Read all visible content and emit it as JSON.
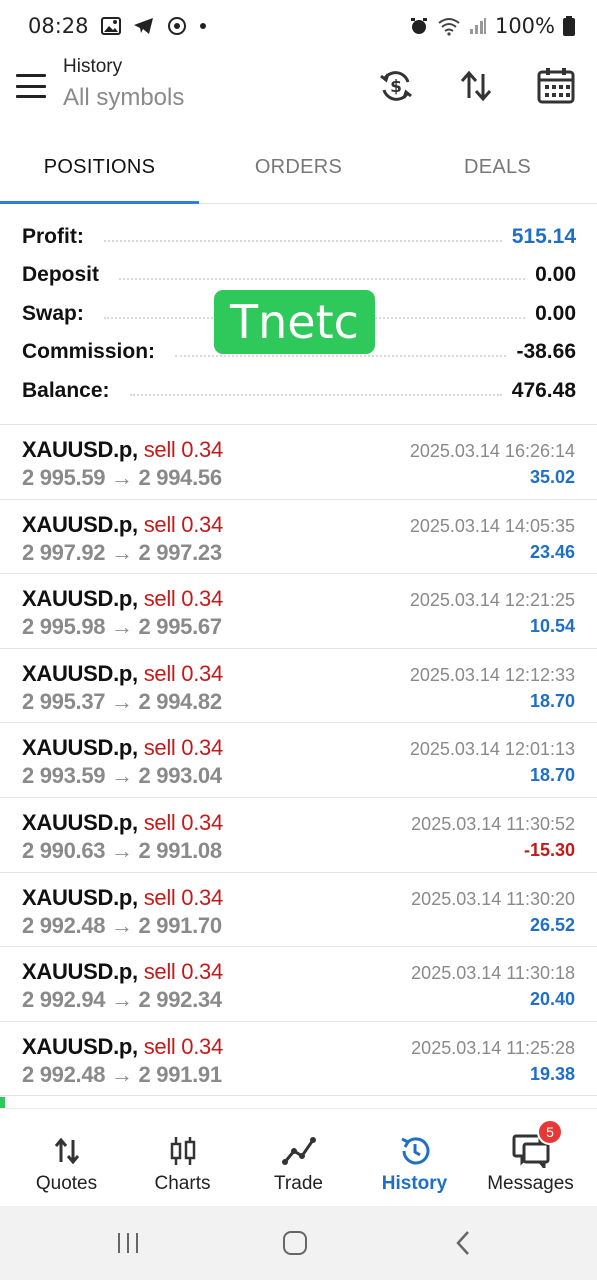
{
  "status_bar": {
    "time": "08:28",
    "battery": "100%",
    "left_icons": [
      "gallery-icon",
      "telegram-icon",
      "app-icon",
      "dot-icon"
    ],
    "right_icons": [
      "alarm-icon",
      "wifi-icon",
      "signal-icon",
      "battery-icon"
    ]
  },
  "header": {
    "title": "History",
    "subtitle": "All symbols",
    "icons": [
      "currency-sync-icon",
      "sort-icon",
      "calendar-icon"
    ]
  },
  "tabs": [
    {
      "label": "POSITIONS",
      "active": true
    },
    {
      "label": "ORDERS",
      "active": false
    },
    {
      "label": "DEALS",
      "active": false
    }
  ],
  "summary": {
    "profit_label": "Profit:",
    "profit_value": "515.14",
    "deposit_label": "Deposit",
    "deposit_value": "0.00",
    "swap_label": "Swap:",
    "swap_value": "0.00",
    "commission_label": "Commission:",
    "commission_value": "-38.66",
    "balance_label": "Balance:",
    "balance_value": "476.48"
  },
  "watermark": "Tnetc",
  "deals": [
    {
      "symbol": "XAUUSD.p,",
      "side": "sell 0.34",
      "prices": "2 995.59 → 2 994.56",
      "time": "2025.03.14 16:26:14",
      "profit": "35.02",
      "negative": false
    },
    {
      "symbol": "XAUUSD.p,",
      "side": "sell 0.34",
      "prices": "2 997.92 → 2 997.23",
      "time": "2025.03.14 14:05:35",
      "profit": "23.46",
      "negative": false
    },
    {
      "symbol": "XAUUSD.p,",
      "side": "sell 0.34",
      "prices": "2 995.98 → 2 995.67",
      "time": "2025.03.14 12:21:25",
      "profit": "10.54",
      "negative": false
    },
    {
      "symbol": "XAUUSD.p,",
      "side": "sell 0.34",
      "prices": "2 995.37 → 2 994.82",
      "time": "2025.03.14 12:12:33",
      "profit": "18.70",
      "negative": false
    },
    {
      "symbol": "XAUUSD.p,",
      "side": "sell 0.34",
      "prices": "2 993.59 → 2 993.04",
      "time": "2025.03.14 12:01:13",
      "profit": "18.70",
      "negative": false
    },
    {
      "symbol": "XAUUSD.p,",
      "side": "sell 0.34",
      "prices": "2 990.63 → 2 991.08",
      "time": "2025.03.14 11:30:52",
      "profit": "-15.30",
      "negative": true
    },
    {
      "symbol": "XAUUSD.p,",
      "side": "sell 0.34",
      "prices": "2 992.48 → 2 991.70",
      "time": "2025.03.14 11:30:20",
      "profit": "26.52",
      "negative": false
    },
    {
      "symbol": "XAUUSD.p,",
      "side": "sell 0.34",
      "prices": "2 992.94 → 2 992.34",
      "time": "2025.03.14 11:30:18",
      "profit": "20.40",
      "negative": false
    },
    {
      "symbol": "XAUUSD.p,",
      "side": "sell 0.34",
      "prices": "2 992.48 → 2 991.91",
      "time": "2025.03.14 11:25:28",
      "profit": "19.38",
      "negative": false
    }
  ],
  "bottom_nav": [
    {
      "label": "Quotes",
      "icon": "quotes-icon",
      "active": false
    },
    {
      "label": "Charts",
      "icon": "candlestick-icon",
      "active": false
    },
    {
      "label": "Trade",
      "icon": "trade-line-icon",
      "active": false
    },
    {
      "label": "History",
      "icon": "history-clock-icon",
      "active": true
    },
    {
      "label": "Messages",
      "icon": "messages-icon",
      "active": false,
      "badge": "5"
    }
  ],
  "colors": {
    "accent_blue": "#1f6fc8",
    "sell_red": "#c41a1a",
    "watermark_green": "#2fc85a"
  }
}
